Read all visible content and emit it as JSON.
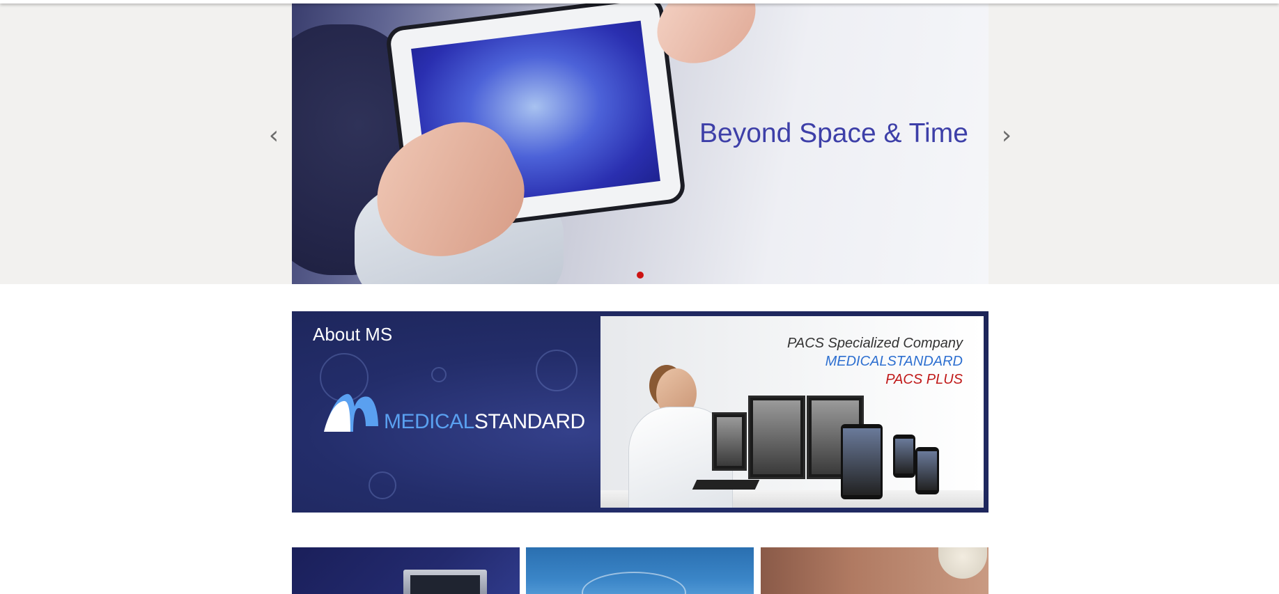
{
  "hero": {
    "title": "Beyond Space & Time",
    "prev_icon": "chevron-left-icon",
    "next_icon": "chevron-right-icon",
    "prev_glyph": "‹",
    "next_glyph": "›",
    "active_dot_color": "#cc1313",
    "title_color": "#3d3fa8"
  },
  "about": {
    "title": "About MS",
    "logo_text_1": "MEDICAL",
    "logo_text_2": "STANDARD",
    "promo_line_1": "PACS Specialized Company",
    "promo_line_2": "MEDICALSTANDARD",
    "promo_line_3": "PACS PLUS"
  },
  "colors": {
    "about_bg": "#232d6a",
    "logo_blue": "#5aa0f0",
    "promo_blue": "#2d6fd0",
    "promo_red": "#c01818"
  }
}
